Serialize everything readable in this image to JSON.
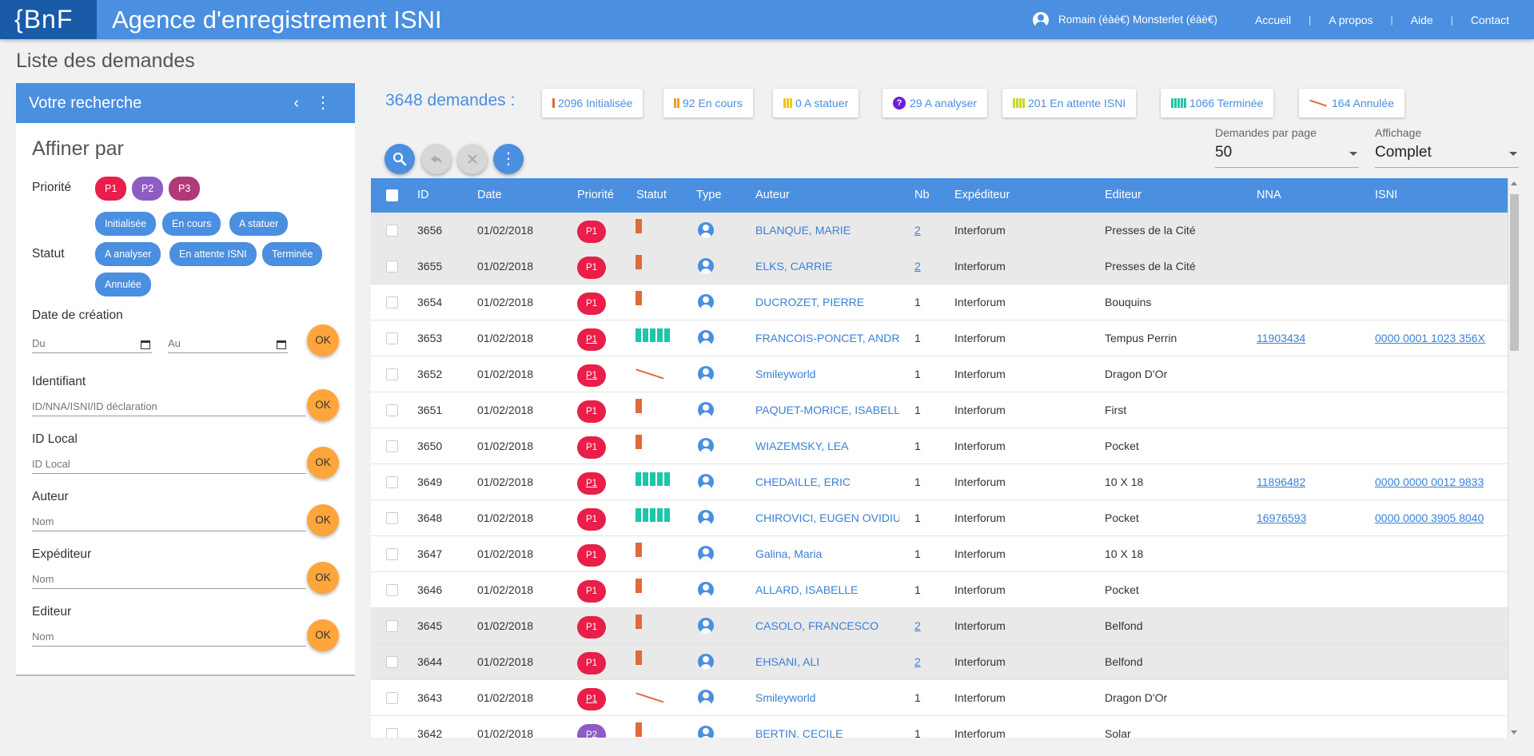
{
  "header": {
    "logo": "{BnF",
    "title": "Agence d'enregistrement ISNI",
    "user": "Romain (éàè€) Monsterlet (éàè€)",
    "nav": [
      "Accueil",
      "A propos",
      "Aide",
      "Contact"
    ]
  },
  "page_title": "Liste des demandes",
  "search_panel": {
    "title": "Votre recherche",
    "refine_title": "Affiner par",
    "priority_label": "Priorité",
    "priorities": [
      "P1",
      "P2",
      "P3"
    ],
    "status_label": "Statut",
    "statuses": [
      "Initialisée",
      "En cours",
      "A statuer",
      "A analyser",
      "En attente ISNI",
      "Terminée",
      "Annulée"
    ],
    "date_label": "Date de création",
    "date_from_placeholder": "Du",
    "date_to_placeholder": "Au",
    "id_label": "Identifiant",
    "id_placeholder": "ID/NNA/ISNI/ID déclaration",
    "local_label": "ID Local",
    "local_placeholder": "ID Local",
    "author_label": "Auteur",
    "author_placeholder": "Nom",
    "sender_label": "Expéditeur",
    "sender_placeholder": "Nom",
    "publisher_label": "Editeur",
    "publisher_placeholder": "Nom",
    "ok_label": "OK"
  },
  "summary": {
    "total": "3648 demandes :",
    "buttons": [
      {
        "label": "2096 Initialisée",
        "icon": "bar-1",
        "color": "#e06a3a"
      },
      {
        "label": "92 En cours",
        "icon": "bar-2",
        "color": "#f0a028"
      },
      {
        "label": "0 A statuer",
        "icon": "bar-3",
        "color": "#f2c21b"
      },
      {
        "label": "29 A analyser",
        "icon": "question-icon",
        "color": "#6a1fd6"
      },
      {
        "label": "201 En attente ISNI",
        "icon": "bar-4",
        "color": "#c6d81e"
      },
      {
        "label": "1066 Terminée",
        "icon": "bar-5",
        "color": "#1cc6a6"
      },
      {
        "label": "164 Annulée",
        "icon": "slash-icon",
        "color": "#e06a3a"
      }
    ]
  },
  "per_page": {
    "label": "Demandes par page",
    "value": "50"
  },
  "display": {
    "label": "Affichage",
    "value": "Complet"
  },
  "table": {
    "columns": [
      "ID",
      "Date",
      "Priorité",
      "Statut",
      "Type",
      "Auteur",
      "Nb",
      "Expéditeur",
      "Editeur",
      "NNA",
      "ISNI"
    ],
    "rows": [
      {
        "id": "3656",
        "date": "01/02/2018",
        "priority": "P1",
        "pul": false,
        "status": "init",
        "author": "BLANQUE, MARIE",
        "nb": "2",
        "nblink": true,
        "sender": "Interforum",
        "publisher": "Presses de la Cité",
        "nna": "",
        "isni": "",
        "shaded": true
      },
      {
        "id": "3655",
        "date": "01/02/2018",
        "priority": "P1",
        "pul": false,
        "status": "init",
        "author": "ELKS, CARRIE",
        "nb": "2",
        "nblink": true,
        "sender": "Interforum",
        "publisher": "Presses de la Cité",
        "nna": "",
        "isni": "",
        "shaded": true
      },
      {
        "id": "3654",
        "date": "01/02/2018",
        "priority": "P1",
        "pul": false,
        "status": "init",
        "author": "DUCROZET, PIERRE",
        "nb": "1",
        "nblink": false,
        "sender": "Interforum",
        "publisher": "Bouquins",
        "nna": "",
        "isni": "",
        "shaded": false
      },
      {
        "id": "3653",
        "date": "01/02/2018",
        "priority": "P1",
        "pul": true,
        "status": "done",
        "author": "FRANCOIS-PONCET, ANDRE",
        "nb": "1",
        "nblink": false,
        "sender": "Interforum",
        "publisher": "Tempus Perrin",
        "nna": "11903434",
        "isni": "0000 0001 1023 356X",
        "shaded": false
      },
      {
        "id": "3652",
        "date": "01/02/2018",
        "priority": "P1",
        "pul": true,
        "status": "cancel",
        "author": "Smileyworld",
        "nb": "1",
        "nblink": false,
        "sender": "Interforum",
        "publisher": "Dragon D'Or",
        "nna": "",
        "isni": "",
        "shaded": false
      },
      {
        "id": "3651",
        "date": "01/02/2018",
        "priority": "P1",
        "pul": false,
        "status": "init",
        "author": "PAQUET-MORICE, ISABELLE",
        "nb": "1",
        "nblink": false,
        "sender": "Interforum",
        "publisher": "First",
        "nna": "",
        "isni": "",
        "shaded": false
      },
      {
        "id": "3650",
        "date": "01/02/2018",
        "priority": "P1",
        "pul": false,
        "status": "init",
        "author": "WIAZEMSKY, LEA",
        "nb": "1",
        "nblink": false,
        "sender": "Interforum",
        "publisher": "Pocket",
        "nna": "",
        "isni": "",
        "shaded": false
      },
      {
        "id": "3649",
        "date": "01/02/2018",
        "priority": "P1",
        "pul": true,
        "status": "done",
        "author": "CHEDAILLE, ERIC",
        "nb": "1",
        "nblink": false,
        "sender": "Interforum",
        "publisher": "10 X 18",
        "nna": "11896482",
        "isni": "0000 0000 0012 9833",
        "shaded": false
      },
      {
        "id": "3648",
        "date": "01/02/2018",
        "priority": "P1",
        "pul": false,
        "status": "done",
        "author": "CHIROVICI, EUGEN OVIDIU",
        "nb": "1",
        "nblink": false,
        "sender": "Interforum",
        "publisher": "Pocket",
        "nna": "16976593",
        "isni": "0000 0000 3905 8040",
        "shaded": false
      },
      {
        "id": "3647",
        "date": "01/02/2018",
        "priority": "P1",
        "pul": false,
        "status": "init",
        "author": "Galina, Maria",
        "nb": "1",
        "nblink": false,
        "sender": "Interforum",
        "publisher": "10 X 18",
        "nna": "",
        "isni": "",
        "shaded": false
      },
      {
        "id": "3646",
        "date": "01/02/2018",
        "priority": "P1",
        "pul": false,
        "status": "init",
        "author": "ALLARD, ISABELLE",
        "nb": "1",
        "nblink": false,
        "sender": "Interforum",
        "publisher": "Pocket",
        "nna": "",
        "isni": "",
        "shaded": false
      },
      {
        "id": "3645",
        "date": "01/02/2018",
        "priority": "P1",
        "pul": false,
        "status": "init",
        "author": "CASOLO, FRANCESCO",
        "nb": "2",
        "nblink": true,
        "sender": "Interforum",
        "publisher": "Belfond",
        "nna": "",
        "isni": "",
        "shaded": true
      },
      {
        "id": "3644",
        "date": "01/02/2018",
        "priority": "P1",
        "pul": false,
        "status": "init",
        "author": "EHSANI, ALI",
        "nb": "2",
        "nblink": true,
        "sender": "Interforum",
        "publisher": "Belfond",
        "nna": "",
        "isni": "",
        "shaded": true
      },
      {
        "id": "3643",
        "date": "01/02/2018",
        "priority": "P1",
        "pul": true,
        "status": "cancel",
        "author": "Smileyworld",
        "nb": "1",
        "nblink": false,
        "sender": "Interforum",
        "publisher": "Dragon D'Or",
        "nna": "",
        "isni": "",
        "shaded": false
      },
      {
        "id": "3642",
        "date": "01/02/2018",
        "priority": "P2",
        "pul": true,
        "status": "init",
        "author": "BERTIN, CECILE",
        "nb": "1",
        "nblink": false,
        "sender": "Interforum",
        "publisher": "Solar",
        "nna": "",
        "isni": "",
        "shaded": false
      }
    ]
  },
  "colors": {
    "primary": "#4a8fe0",
    "logo_bg": "#1a5ba8",
    "priority_p1": "#e91e4a",
    "priority_p2": "#8e5cc5",
    "priority_p3": "#b03a78",
    "ok_button": "#ffa53b",
    "status_init": "#e06a3a",
    "status_done": "#1cc6a6"
  }
}
